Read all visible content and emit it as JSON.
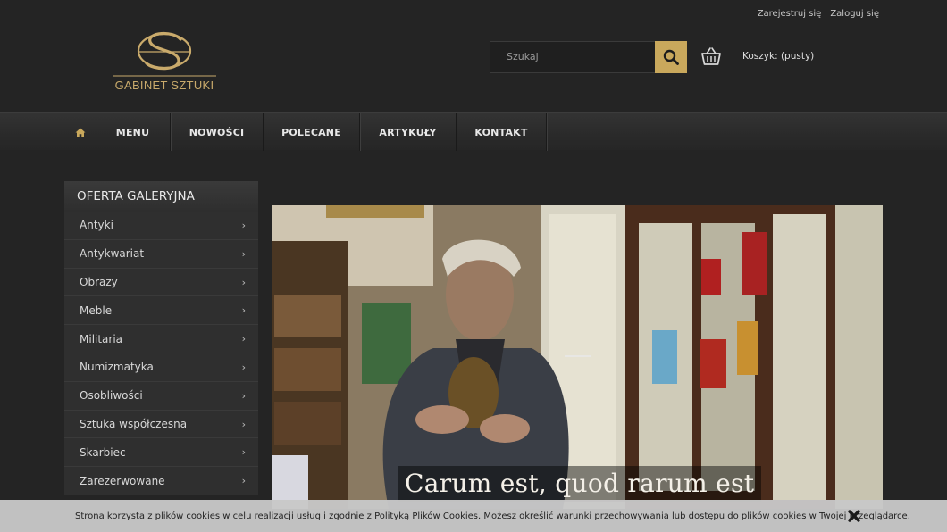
{
  "header": {
    "top_links": {
      "register": "Zarejestruj się",
      "login": "Zaloguj się"
    },
    "logo_text": "GABINET SZTUKI",
    "search": {
      "placeholder": "Szukaj"
    },
    "cart_label": "Koszyk: (pusty)"
  },
  "nav": {
    "items": [
      {
        "label": "MENU"
      },
      {
        "label": "NOWOŚCI"
      },
      {
        "label": "POLECANE"
      },
      {
        "label": "ARTYKUŁY"
      },
      {
        "label": "KONTAKT"
      }
    ]
  },
  "sidebar": {
    "title": "OFERTA GALERYJNA",
    "categories": [
      "Antyki",
      "Antykwariat",
      "Obrazy",
      "Meble",
      "Militaria",
      "Numizmatyka",
      "Osobliwości",
      "Sztuka współczesna",
      "Skarbiec",
      "Zarezerwowane"
    ]
  },
  "slider": {
    "caption": "Carum est, quod rarum est"
  },
  "cookie": {
    "text": "Strona korzysta z plików cookies w celu realizacji usług i zgodnie z Polityką Plików Cookies. Możesz określić warunki przechowywania lub dostępu do plików cookies w Twojej przeglądarce."
  },
  "colors": {
    "accent_gold": "#c9a85c",
    "background": "#242424"
  },
  "icons": [
    "home-icon",
    "search-icon",
    "basket-icon",
    "chevron-right-icon",
    "close-icon"
  ]
}
